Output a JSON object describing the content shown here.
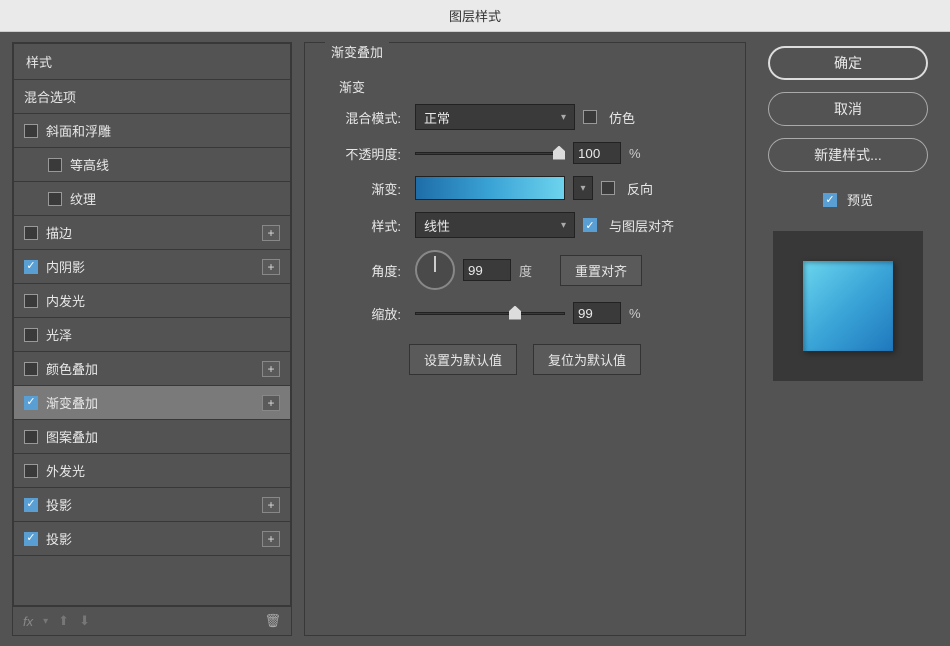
{
  "title": "图层样式",
  "left": {
    "header": "样式",
    "blend_options": "混合选项",
    "items": [
      {
        "label": "斜面和浮雕",
        "checked": false,
        "plus": false,
        "indent": false
      },
      {
        "label": "等高线",
        "checked": false,
        "plus": false,
        "indent": true
      },
      {
        "label": "纹理",
        "checked": false,
        "plus": false,
        "indent": true
      },
      {
        "label": "描边",
        "checked": false,
        "plus": true,
        "indent": false
      },
      {
        "label": "内阴影",
        "checked": true,
        "plus": true,
        "indent": false
      },
      {
        "label": "内发光",
        "checked": false,
        "plus": false,
        "indent": false
      },
      {
        "label": "光泽",
        "checked": false,
        "plus": false,
        "indent": false
      },
      {
        "label": "颜色叠加",
        "checked": false,
        "plus": true,
        "indent": false
      },
      {
        "label": "渐变叠加",
        "checked": true,
        "plus": true,
        "indent": false,
        "selected": true
      },
      {
        "label": "图案叠加",
        "checked": false,
        "plus": false,
        "indent": false
      },
      {
        "label": "外发光",
        "checked": false,
        "plus": false,
        "indent": false
      },
      {
        "label": "投影",
        "checked": true,
        "plus": true,
        "indent": false
      },
      {
        "label": "投影",
        "checked": true,
        "plus": true,
        "indent": false
      }
    ],
    "fx_label": "fx"
  },
  "mid": {
    "group_title": "渐变叠加",
    "sub_title": "渐变",
    "blend_mode_label": "混合模式:",
    "blend_mode_value": "正常",
    "dither_label": "仿色",
    "opacity_label": "不透明度:",
    "opacity_value": "100",
    "opacity_unit": "%",
    "gradient_label": "渐变:",
    "reverse_label": "反向",
    "style_label": "样式:",
    "style_value": "线性",
    "align_label": "与图层对齐",
    "angle_label": "角度:",
    "angle_value": "99",
    "angle_unit": "度",
    "reset_align": "重置对齐",
    "scale_label": "缩放:",
    "scale_value": "99",
    "scale_unit": "%",
    "set_default": "设置为默认值",
    "reset_default": "复位为默认值"
  },
  "right": {
    "ok": "确定",
    "cancel": "取消",
    "new_style": "新建样式...",
    "preview": "预览"
  }
}
